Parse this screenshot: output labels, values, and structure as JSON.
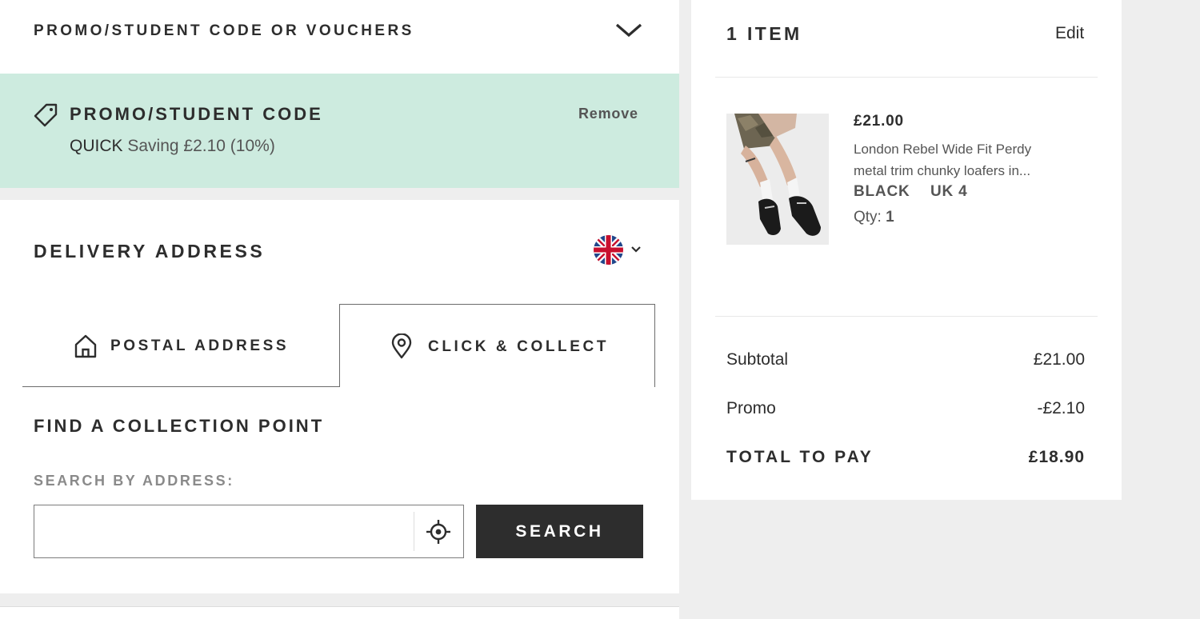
{
  "promo_toggle": {
    "label": "PROMO/STUDENT CODE OR VOUCHERS"
  },
  "promo_applied": {
    "title": "PROMO/STUDENT CODE",
    "remove_label": "Remove",
    "code": "QUICK",
    "saving_text": "Saving £2.10 (10%)"
  },
  "delivery": {
    "title": "DELIVERY ADDRESS",
    "country_flag_icon": "uk-flag-icon",
    "tabs": [
      {
        "label": "POSTAL ADDRESS",
        "icon": "house-icon"
      },
      {
        "label": "CLICK & COLLECT",
        "icon": "map-pin-icon",
        "selected": true
      }
    ],
    "find_title": "FIND A COLLECTION POINT",
    "search_label": "SEARCH BY ADDRESS:",
    "search_value": "",
    "search_button": "SEARCH",
    "locate_icon": "crosshair-icon"
  },
  "summary": {
    "items_title": "1 ITEM",
    "edit_label": "Edit",
    "item": {
      "price": "£21.00",
      "name_line1": "London Rebel Wide Fit Perdy",
      "name_line2": "metal trim chunky loafers in...",
      "color": "BLACK",
      "size": "UK 4",
      "qty_label": "Qty:",
      "qty_value": "1"
    },
    "subtotal_label": "Subtotal",
    "subtotal_value": "£21.00",
    "promo_label": "Promo",
    "promo_value": "-£2.10",
    "total_label": "TOTAL TO PAY",
    "total_value": "£18.90"
  },
  "colors": {
    "promo_bg": "#cdebdf",
    "text_dark": "#2d2d2d",
    "button_bg": "#2d2d2d",
    "page_bg": "#eeeeee"
  }
}
